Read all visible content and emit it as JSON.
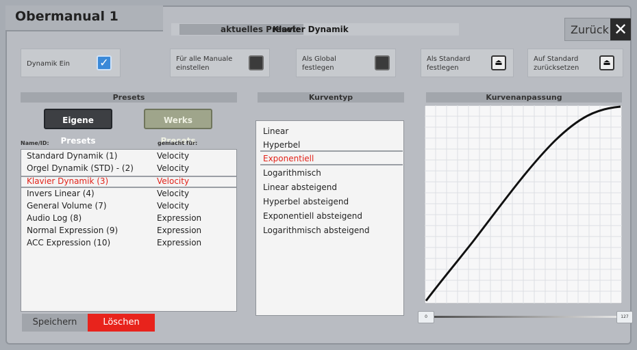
{
  "window": {
    "title": "Obermanual 1",
    "preset_label": "aktuelles Preset:",
    "preset_value": "Klavier Dynamik",
    "back_label": "Zurück",
    "close_glyph": "✕"
  },
  "options": [
    {
      "label": "Dynamik Ein",
      "state": "checked"
    },
    {
      "label": "Für alle Manuale einstellen",
      "label_lines": [
        "Für alle Manuale",
        "einstellen"
      ],
      "state": "unchecked"
    },
    {
      "label": "Als Global festlegen",
      "label_lines": [
        "Als Global",
        "festlegen"
      ],
      "state": "unchecked"
    },
    {
      "label": "Als Standard festlegen",
      "label_lines": [
        "Als Standard",
        "festlegen"
      ],
      "icon": "save-icon"
    },
    {
      "label": "Auf Standard zurücksetzen",
      "label_lines": [
        "Auf Standard",
        "zurücksetzen"
      ],
      "icon": "save-icon"
    }
  ],
  "presets": {
    "header": "Presets",
    "eigene_label": "Eigene Presets",
    "werks_label": "Werks Presets",
    "col_name": "Name/ID:",
    "col_for": "gemacht für:",
    "rows": [
      {
        "name": "Standard Dynamik (1)",
        "for": "Velocity"
      },
      {
        "name": "Orgel Dynamik (STD) - (2)",
        "for": "Velocity"
      },
      {
        "name": "Klavier Dynamik (3)",
        "for": "Velocity",
        "selected": true
      },
      {
        "name": "Invers Linear (4)",
        "for": "Velocity"
      },
      {
        "name": "General Volume (7)",
        "for": "Velocity"
      },
      {
        "name": "Audio Log (8)",
        "for": "Expression"
      },
      {
        "name": "Normal Expression (9)",
        "for": "Expression"
      },
      {
        "name": "ACC Expression (10)",
        "for": "Expression"
      }
    ],
    "save_label": "Speichern",
    "delete_label": "Löschen"
  },
  "kurventyp": {
    "header": "Kurventyp",
    "items": [
      "Linear",
      "Hyperbel",
      "Exponentiell",
      "Logarithmisch",
      "Linear absteigend",
      "Hyperbel absteigend",
      "Exponentiell absteigend",
      "Logarithmisch absteigend"
    ],
    "selected": "Exponentiell"
  },
  "kurvenanpassung": {
    "header": "Kurvenanpassung",
    "slider_min": "0",
    "slider_max": "127"
  },
  "colors": {
    "accent_red": "#e2231a",
    "check_blue": "#3a89d8"
  }
}
